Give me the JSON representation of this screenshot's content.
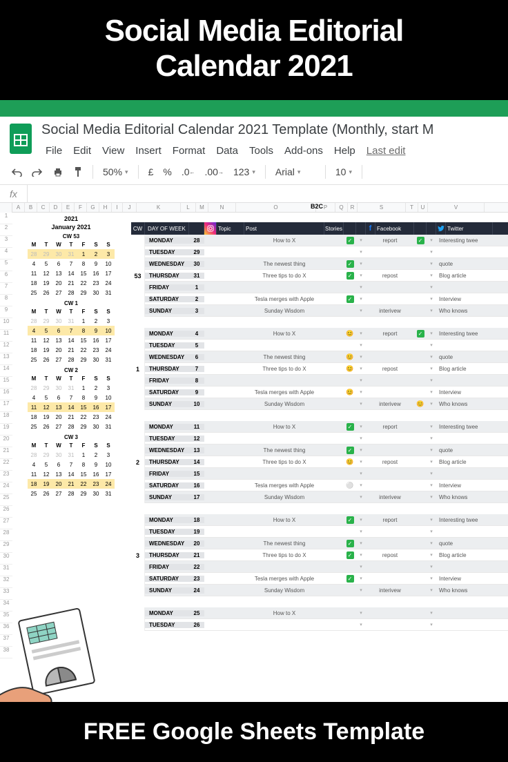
{
  "banner": {
    "title_line1": "Social Media Editorial",
    "title_line2": "Calendar 2021",
    "footer": "FREE Google Sheets Template"
  },
  "doc": {
    "title": "Social Media Editorial Calendar 2021 Template (Monthly, start M",
    "last_edit": "Last edit"
  },
  "menu": [
    "File",
    "Edit",
    "View",
    "Insert",
    "Format",
    "Data",
    "Tools",
    "Add-ons",
    "Help"
  ],
  "toolbar": {
    "zoom": "50%",
    "currency": "£",
    "percent": "%",
    "dec_dec": ".0",
    "dec_inc": ".00",
    "numfmt": "123",
    "font": "Arial",
    "size": "10"
  },
  "columns": [
    "A",
    "B",
    "C",
    "D",
    "E",
    "F",
    "G",
    "H",
    "I",
    "J",
    "K",
    "L",
    "M",
    "N",
    "O",
    "P",
    "Q",
    "R",
    "S",
    "T",
    "U",
    "V"
  ],
  "sheet": {
    "year": "2021",
    "month": "January 2021",
    "b2c": "B2C",
    "hdr": {
      "cw": "CW",
      "dow": "DAY OF WEEK",
      "topic": "Topic",
      "post": "Post",
      "stories": "Stories",
      "fb": "Facebook",
      "tw": "Twitter"
    },
    "mini_cals": [
      {
        "cw": "CW 53",
        "hl_row": 0,
        "rows": [
          [
            "28",
            "29",
            "30",
            "31",
            "1",
            "2",
            "3"
          ],
          [
            "4",
            "5",
            "6",
            "7",
            "8",
            "9",
            "10"
          ],
          [
            "11",
            "12",
            "13",
            "14",
            "15",
            "16",
            "17"
          ],
          [
            "18",
            "19",
            "20",
            "21",
            "22",
            "23",
            "24"
          ],
          [
            "25",
            "26",
            "27",
            "28",
            "29",
            "30",
            "31"
          ]
        ],
        "grey_first": 4
      },
      {
        "cw": "CW 1",
        "hl_row": 1,
        "rows": [
          [
            "28",
            "29",
            "30",
            "31",
            "1",
            "2",
            "3"
          ],
          [
            "4",
            "5",
            "6",
            "7",
            "8",
            "9",
            "10"
          ],
          [
            "11",
            "12",
            "13",
            "14",
            "15",
            "16",
            "17"
          ],
          [
            "18",
            "19",
            "20",
            "21",
            "22",
            "23",
            "24"
          ],
          [
            "25",
            "26",
            "27",
            "28",
            "29",
            "30",
            "31"
          ]
        ],
        "grey_first": 4
      },
      {
        "cw": "CW 2",
        "hl_row": 2,
        "rows": [
          [
            "28",
            "29",
            "30",
            "31",
            "1",
            "2",
            "3"
          ],
          [
            "4",
            "5",
            "6",
            "7",
            "8",
            "9",
            "10"
          ],
          [
            "11",
            "12",
            "13",
            "14",
            "15",
            "16",
            "17"
          ],
          [
            "18",
            "19",
            "20",
            "21",
            "22",
            "23",
            "24"
          ],
          [
            "25",
            "26",
            "27",
            "28",
            "29",
            "30",
            "31"
          ]
        ],
        "grey_first": 4
      },
      {
        "cw": "CW 3",
        "hl_row": 3,
        "rows": [
          [
            "28",
            "29",
            "30",
            "31",
            "1",
            "2",
            "3"
          ],
          [
            "4",
            "5",
            "6",
            "7",
            "8",
            "9",
            "10"
          ],
          [
            "11",
            "12",
            "13",
            "14",
            "15",
            "16",
            "17"
          ],
          [
            "18",
            "19",
            "20",
            "21",
            "22",
            "23",
            "24"
          ],
          [
            "25",
            "26",
            "27",
            "28",
            "29",
            "30",
            "31"
          ]
        ],
        "grey_first": 4
      }
    ],
    "day_labels": [
      "M",
      "T",
      "W",
      "T",
      "F",
      "S",
      "S"
    ],
    "weeks": [
      {
        "cw": "53",
        "days": [
          {
            "dow": "MONDAY",
            "d": "28",
            "post": "How to X",
            "chk1": "g",
            "fb": "report",
            "chk2": "g",
            "tw": "Interesting twee"
          },
          {
            "dow": "TUESDAY",
            "d": "29",
            "post": "",
            "chk1": "",
            "fb": "",
            "chk2": "",
            "tw": ""
          },
          {
            "dow": "WEDNESDAY",
            "d": "30",
            "post": "The newest thing",
            "chk1": "g",
            "fb": "",
            "chk2": "",
            "tw": "quote"
          },
          {
            "dow": "THURSDAY",
            "d": "31",
            "post": "Three tips to do X",
            "chk1": "g",
            "fb": "repost",
            "chk2": "",
            "tw": "Blog article"
          },
          {
            "dow": "FRIDAY",
            "d": "1",
            "post": "",
            "chk1": "",
            "fb": "",
            "chk2": "",
            "tw": ""
          },
          {
            "dow": "SATURDAY",
            "d": "2",
            "post": "Tesla merges with Apple",
            "chk1": "g",
            "fb": "",
            "chk2": "",
            "tw": "Interview"
          },
          {
            "dow": "SUNDAY",
            "d": "3",
            "post": "Sunday Wisdom",
            "chk1": "",
            "fb": "interivew",
            "chk2": "",
            "tw": "Who knows"
          }
        ]
      },
      {
        "cw": "1",
        "days": [
          {
            "dow": "MONDAY",
            "d": "4",
            "post": "How to X",
            "chk1": "e",
            "fb": "report",
            "chk2": "g",
            "tw": "Interesting twee"
          },
          {
            "dow": "TUESDAY",
            "d": "5",
            "post": "",
            "chk1": "",
            "fb": "",
            "chk2": "",
            "tw": ""
          },
          {
            "dow": "WEDNESDAY",
            "d": "6",
            "post": "The newest thing",
            "chk1": "e",
            "fb": "",
            "chk2": "",
            "tw": "quote"
          },
          {
            "dow": "THURSDAY",
            "d": "7",
            "post": "Three tips to do X",
            "chk1": "e",
            "fb": "repost",
            "chk2": "",
            "tw": "Blog article"
          },
          {
            "dow": "FRIDAY",
            "d": "8",
            "post": "",
            "chk1": "",
            "fb": "",
            "chk2": "",
            "tw": ""
          },
          {
            "dow": "SATURDAY",
            "d": "9",
            "post": "Tesla merges with Apple",
            "chk1": "e",
            "fb": "",
            "chk2": "",
            "tw": "Interview"
          },
          {
            "dow": "SUNDAY",
            "d": "10",
            "post": "Sunday Wisdom",
            "chk1": "",
            "fb": "interivew",
            "chk2": "e",
            "tw": "Who knows"
          }
        ]
      },
      {
        "cw": "2",
        "days": [
          {
            "dow": "MONDAY",
            "d": "11",
            "post": "How to X",
            "chk1": "g",
            "fb": "report",
            "chk2": "",
            "tw": "Interesting twee"
          },
          {
            "dow": "TUESDAY",
            "d": "12",
            "post": "",
            "chk1": "",
            "fb": "",
            "chk2": "",
            "tw": ""
          },
          {
            "dow": "WEDNESDAY",
            "d": "13",
            "post": "The newest thing",
            "chk1": "g",
            "fb": "",
            "chk2": "",
            "tw": "quote"
          },
          {
            "dow": "THURSDAY",
            "d": "14",
            "post": "Three tips to do X",
            "chk1": "e",
            "fb": "repost",
            "chk2": "",
            "tw": "Blog article"
          },
          {
            "dow": "FRIDAY",
            "d": "15",
            "post": "",
            "chk1": "",
            "fb": "",
            "chk2": "",
            "tw": ""
          },
          {
            "dow": "SATURDAY",
            "d": "16",
            "post": "Tesla merges with Apple",
            "chk1": "w",
            "fb": "",
            "chk2": "",
            "tw": "Interview"
          },
          {
            "dow": "SUNDAY",
            "d": "17",
            "post": "Sunday Wisdom",
            "chk1": "",
            "fb": "interivew",
            "chk2": "",
            "tw": "Who knows"
          }
        ]
      },
      {
        "cw": "3",
        "days": [
          {
            "dow": "MONDAY",
            "d": "18",
            "post": "How to X",
            "chk1": "g",
            "fb": "report",
            "chk2": "",
            "tw": "Interesting twee"
          },
          {
            "dow": "TUESDAY",
            "d": "19",
            "post": "",
            "chk1": "",
            "fb": "",
            "chk2": "",
            "tw": ""
          },
          {
            "dow": "WEDNESDAY",
            "d": "20",
            "post": "The newest thing",
            "chk1": "g",
            "fb": "",
            "chk2": "",
            "tw": "quote"
          },
          {
            "dow": "THURSDAY",
            "d": "21",
            "post": "Three tips to do X",
            "chk1": "g",
            "fb": "repost",
            "chk2": "",
            "tw": "Blog article"
          },
          {
            "dow": "FRIDAY",
            "d": "22",
            "post": "",
            "chk1": "",
            "fb": "",
            "chk2": "",
            "tw": ""
          },
          {
            "dow": "SATURDAY",
            "d": "23",
            "post": "Tesla merges with Apple",
            "chk1": "g",
            "fb": "",
            "chk2": "",
            "tw": "Interview"
          },
          {
            "dow": "SUNDAY",
            "d": "24",
            "post": "Sunday Wisdom",
            "chk1": "",
            "fb": "interivew",
            "chk2": "",
            "tw": "Who knows"
          }
        ]
      },
      {
        "cw": "",
        "days": [
          {
            "dow": "MONDAY",
            "d": "25",
            "post": "How to X",
            "chk1": "",
            "fb": "",
            "chk2": "",
            "tw": ""
          },
          {
            "dow": "TUESDAY",
            "d": "26",
            "post": "",
            "chk1": "",
            "fb": "",
            "chk2": "",
            "tw": ""
          }
        ]
      }
    ]
  }
}
